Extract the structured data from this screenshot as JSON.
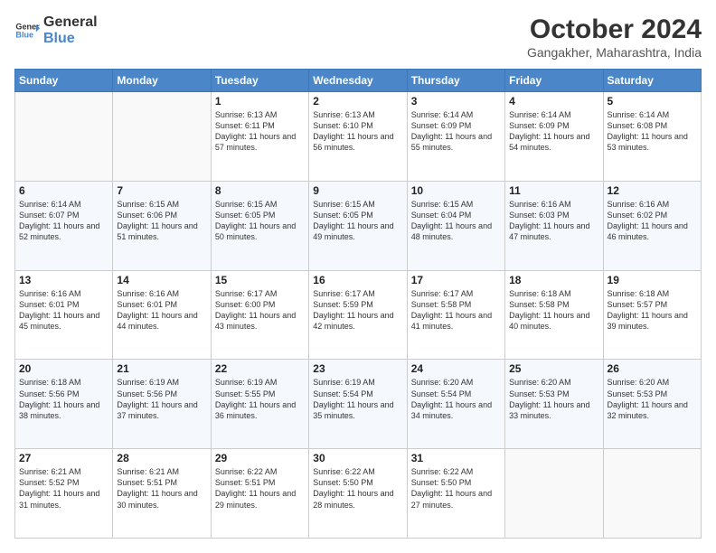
{
  "logo": {
    "text_general": "General",
    "text_blue": "Blue"
  },
  "header": {
    "month_title": "October 2024",
    "subtitle": "Gangakher, Maharashtra, India"
  },
  "weekdays": [
    "Sunday",
    "Monday",
    "Tuesday",
    "Wednesday",
    "Thursday",
    "Friday",
    "Saturday"
  ],
  "weeks": [
    [
      {
        "day": "",
        "sunrise": "",
        "sunset": "",
        "daylight": ""
      },
      {
        "day": "",
        "sunrise": "",
        "sunset": "",
        "daylight": ""
      },
      {
        "day": "1",
        "sunrise": "Sunrise: 6:13 AM",
        "sunset": "Sunset: 6:11 PM",
        "daylight": "Daylight: 11 hours and 57 minutes."
      },
      {
        "day": "2",
        "sunrise": "Sunrise: 6:13 AM",
        "sunset": "Sunset: 6:10 PM",
        "daylight": "Daylight: 11 hours and 56 minutes."
      },
      {
        "day": "3",
        "sunrise": "Sunrise: 6:14 AM",
        "sunset": "Sunset: 6:09 PM",
        "daylight": "Daylight: 11 hours and 55 minutes."
      },
      {
        "day": "4",
        "sunrise": "Sunrise: 6:14 AM",
        "sunset": "Sunset: 6:09 PM",
        "daylight": "Daylight: 11 hours and 54 minutes."
      },
      {
        "day": "5",
        "sunrise": "Sunrise: 6:14 AM",
        "sunset": "Sunset: 6:08 PM",
        "daylight": "Daylight: 11 hours and 53 minutes."
      }
    ],
    [
      {
        "day": "6",
        "sunrise": "Sunrise: 6:14 AM",
        "sunset": "Sunset: 6:07 PM",
        "daylight": "Daylight: 11 hours and 52 minutes."
      },
      {
        "day": "7",
        "sunrise": "Sunrise: 6:15 AM",
        "sunset": "Sunset: 6:06 PM",
        "daylight": "Daylight: 11 hours and 51 minutes."
      },
      {
        "day": "8",
        "sunrise": "Sunrise: 6:15 AM",
        "sunset": "Sunset: 6:05 PM",
        "daylight": "Daylight: 11 hours and 50 minutes."
      },
      {
        "day": "9",
        "sunrise": "Sunrise: 6:15 AM",
        "sunset": "Sunset: 6:05 PM",
        "daylight": "Daylight: 11 hours and 49 minutes."
      },
      {
        "day": "10",
        "sunrise": "Sunrise: 6:15 AM",
        "sunset": "Sunset: 6:04 PM",
        "daylight": "Daylight: 11 hours and 48 minutes."
      },
      {
        "day": "11",
        "sunrise": "Sunrise: 6:16 AM",
        "sunset": "Sunset: 6:03 PM",
        "daylight": "Daylight: 11 hours and 47 minutes."
      },
      {
        "day": "12",
        "sunrise": "Sunrise: 6:16 AM",
        "sunset": "Sunset: 6:02 PM",
        "daylight": "Daylight: 11 hours and 46 minutes."
      }
    ],
    [
      {
        "day": "13",
        "sunrise": "Sunrise: 6:16 AM",
        "sunset": "Sunset: 6:01 PM",
        "daylight": "Daylight: 11 hours and 45 minutes."
      },
      {
        "day": "14",
        "sunrise": "Sunrise: 6:16 AM",
        "sunset": "Sunset: 6:01 PM",
        "daylight": "Daylight: 11 hours and 44 minutes."
      },
      {
        "day": "15",
        "sunrise": "Sunrise: 6:17 AM",
        "sunset": "Sunset: 6:00 PM",
        "daylight": "Daylight: 11 hours and 43 minutes."
      },
      {
        "day": "16",
        "sunrise": "Sunrise: 6:17 AM",
        "sunset": "Sunset: 5:59 PM",
        "daylight": "Daylight: 11 hours and 42 minutes."
      },
      {
        "day": "17",
        "sunrise": "Sunrise: 6:17 AM",
        "sunset": "Sunset: 5:58 PM",
        "daylight": "Daylight: 11 hours and 41 minutes."
      },
      {
        "day": "18",
        "sunrise": "Sunrise: 6:18 AM",
        "sunset": "Sunset: 5:58 PM",
        "daylight": "Daylight: 11 hours and 40 minutes."
      },
      {
        "day": "19",
        "sunrise": "Sunrise: 6:18 AM",
        "sunset": "Sunset: 5:57 PM",
        "daylight": "Daylight: 11 hours and 39 minutes."
      }
    ],
    [
      {
        "day": "20",
        "sunrise": "Sunrise: 6:18 AM",
        "sunset": "Sunset: 5:56 PM",
        "daylight": "Daylight: 11 hours and 38 minutes."
      },
      {
        "day": "21",
        "sunrise": "Sunrise: 6:19 AM",
        "sunset": "Sunset: 5:56 PM",
        "daylight": "Daylight: 11 hours and 37 minutes."
      },
      {
        "day": "22",
        "sunrise": "Sunrise: 6:19 AM",
        "sunset": "Sunset: 5:55 PM",
        "daylight": "Daylight: 11 hours and 36 minutes."
      },
      {
        "day": "23",
        "sunrise": "Sunrise: 6:19 AM",
        "sunset": "Sunset: 5:54 PM",
        "daylight": "Daylight: 11 hours and 35 minutes."
      },
      {
        "day": "24",
        "sunrise": "Sunrise: 6:20 AM",
        "sunset": "Sunset: 5:54 PM",
        "daylight": "Daylight: 11 hours and 34 minutes."
      },
      {
        "day": "25",
        "sunrise": "Sunrise: 6:20 AM",
        "sunset": "Sunset: 5:53 PM",
        "daylight": "Daylight: 11 hours and 33 minutes."
      },
      {
        "day": "26",
        "sunrise": "Sunrise: 6:20 AM",
        "sunset": "Sunset: 5:53 PM",
        "daylight": "Daylight: 11 hours and 32 minutes."
      }
    ],
    [
      {
        "day": "27",
        "sunrise": "Sunrise: 6:21 AM",
        "sunset": "Sunset: 5:52 PM",
        "daylight": "Daylight: 11 hours and 31 minutes."
      },
      {
        "day": "28",
        "sunrise": "Sunrise: 6:21 AM",
        "sunset": "Sunset: 5:51 PM",
        "daylight": "Daylight: 11 hours and 30 minutes."
      },
      {
        "day": "29",
        "sunrise": "Sunrise: 6:22 AM",
        "sunset": "Sunset: 5:51 PM",
        "daylight": "Daylight: 11 hours and 29 minutes."
      },
      {
        "day": "30",
        "sunrise": "Sunrise: 6:22 AM",
        "sunset": "Sunset: 5:50 PM",
        "daylight": "Daylight: 11 hours and 28 minutes."
      },
      {
        "day": "31",
        "sunrise": "Sunrise: 6:22 AM",
        "sunset": "Sunset: 5:50 PM",
        "daylight": "Daylight: 11 hours and 27 minutes."
      },
      {
        "day": "",
        "sunrise": "",
        "sunset": "",
        "daylight": ""
      },
      {
        "day": "",
        "sunrise": "",
        "sunset": "",
        "daylight": ""
      }
    ]
  ]
}
